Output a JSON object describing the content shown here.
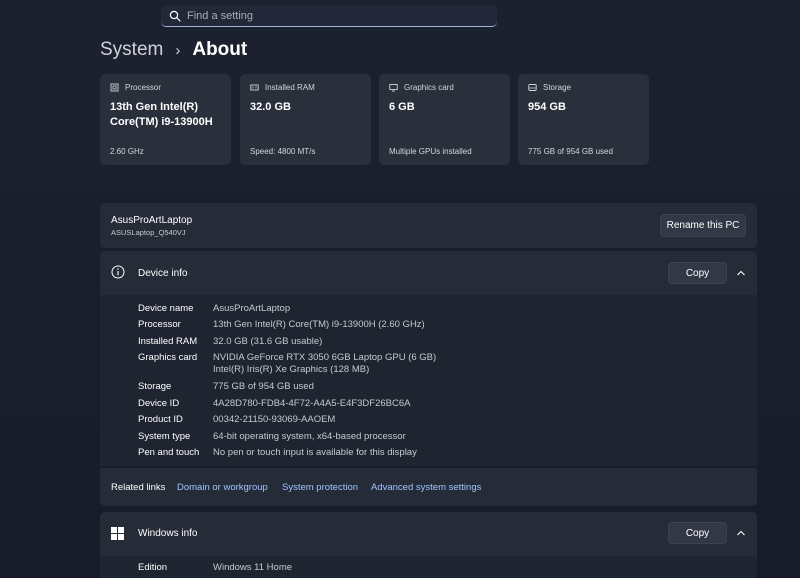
{
  "search": {
    "placeholder": "Find a setting"
  },
  "breadcrumb": {
    "parent": "System",
    "separator": "›",
    "current": "About"
  },
  "cards": [
    {
      "label": "Processor",
      "value": "13th Gen Intel(R) Core(TM) i9-13900H",
      "sub": "2.60 GHz",
      "icon": "processor-icon"
    },
    {
      "label": "Installed RAM",
      "value": "32.0 GB",
      "sub": "Speed: 4800 MT/s",
      "icon": "ram-icon"
    },
    {
      "label": "Graphics card",
      "value": "6 GB",
      "sub": "Multiple GPUs installed",
      "icon": "graphics-card-icon"
    },
    {
      "label": "Storage",
      "value": "954 GB",
      "sub": "775 GB of 954 GB used",
      "icon": "storage-icon"
    }
  ],
  "pc": {
    "name": "AsusProArtLaptop",
    "model": "ASUSLaptop_Q540VJ",
    "rename_label": "Rename this PC"
  },
  "device_info": {
    "title": "Device info",
    "copy_label": "Copy",
    "specs": [
      {
        "label": "Device name",
        "value": "AsusProArtLaptop"
      },
      {
        "label": "Processor",
        "value": "13th Gen Intel(R) Core(TM) i9-13900H (2.60 GHz)"
      },
      {
        "label": "Installed RAM",
        "value": "32.0 GB (31.6 GB usable)"
      },
      {
        "label": "Graphics card",
        "value": "NVIDIA GeForce RTX 3050 6GB Laptop GPU (6 GB)",
        "value2": "Intel(R) Iris(R) Xe Graphics (128 MB)"
      },
      {
        "label": "Storage",
        "value": "775 GB of 954 GB used"
      },
      {
        "label": "Device ID",
        "value": "4A28D780-FDB4-4F72-A4A5-E4F3DF26BC6A"
      },
      {
        "label": "Product ID",
        "value": "00342-21150-93069-AAOEM"
      },
      {
        "label": "System type",
        "value": "64-bit operating system, x64-based processor"
      },
      {
        "label": "Pen and touch",
        "value": "No pen or touch input is available for this display"
      }
    ]
  },
  "related": {
    "label": "Related links",
    "links": [
      "Domain or workgroup",
      "System protection",
      "Advanced system settings"
    ]
  },
  "windows_info": {
    "title": "Windows info",
    "copy_label": "Copy",
    "specs": [
      {
        "label": "Edition",
        "value": "Windows 11 Home"
      }
    ]
  },
  "colors": {
    "link": "#9ec5ff",
    "card_bg": "#2a2f3c",
    "panel_bg": "#262b38",
    "body_bg": "#1f2431"
  }
}
